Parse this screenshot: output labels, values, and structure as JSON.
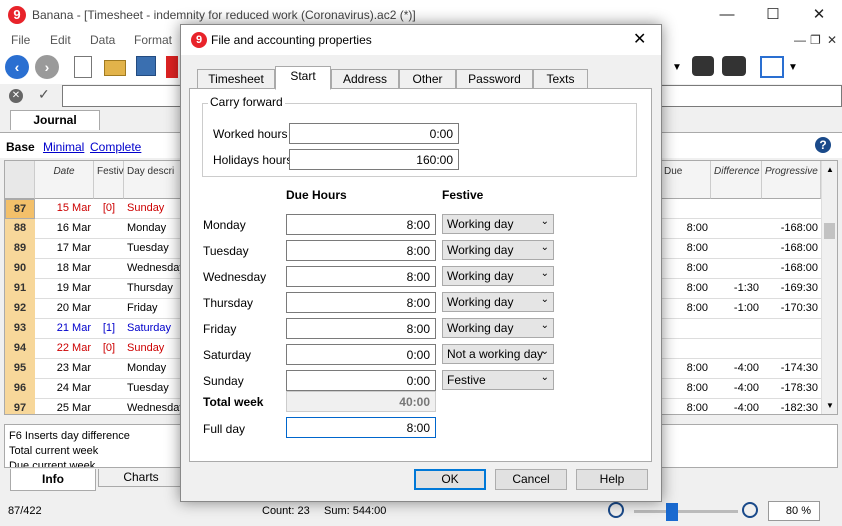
{
  "window": {
    "title": "Banana - [Timesheet - indemnity for reduced work (Coronavirus).ac2 (*)]",
    "logo": "9",
    "minimize": "—",
    "maximize": "☐",
    "close": "✕"
  },
  "menu": [
    "File",
    "Edit",
    "Data",
    "Format"
  ],
  "main": {
    "journal_tab": "Journal",
    "views": {
      "base": "Base",
      "minimal": "Minimal",
      "complete": "Complete"
    },
    "help": "?",
    "columns": {
      "date": "Date",
      "festive": "Festive",
      "day": "Day descri",
      "due": "Due",
      "difference": "Difference",
      "progressive": "Progressive"
    },
    "rows": [
      {
        "n": "87",
        "date": "15 Mar",
        "festive": "[0]",
        "day": "Sunday",
        "due": "",
        "diff": "",
        "prog": "",
        "color": "red"
      },
      {
        "n": "88",
        "date": "16 Mar",
        "festive": "",
        "day": "Monday",
        "due": "8:00",
        "diff": "",
        "prog": "-168:00",
        "color": ""
      },
      {
        "n": "89",
        "date": "17 Mar",
        "festive": "",
        "day": "Tuesday",
        "due": "8:00",
        "diff": "",
        "prog": "-168:00",
        "color": ""
      },
      {
        "n": "90",
        "date": "18 Mar",
        "festive": "",
        "day": "Wednesday",
        "due": "8:00",
        "diff": "",
        "prog": "-168:00",
        "color": ""
      },
      {
        "n": "91",
        "date": "19 Mar",
        "festive": "",
        "day": "Thursday",
        "due": "8:00",
        "diff": "-1:30",
        "prog": "-169:30",
        "color": ""
      },
      {
        "n": "92",
        "date": "20 Mar",
        "festive": "",
        "day": "Friday",
        "due": "8:00",
        "diff": "-1:00",
        "prog": "-170:30",
        "color": ""
      },
      {
        "n": "93",
        "date": "21 Mar",
        "festive": "[1]",
        "day": "Saturday",
        "due": "",
        "diff": "",
        "prog": "",
        "color": "blue"
      },
      {
        "n": "94",
        "date": "22 Mar",
        "festive": "[0]",
        "day": "Sunday",
        "due": "",
        "diff": "",
        "prog": "",
        "color": "red"
      },
      {
        "n": "95",
        "date": "23 Mar",
        "festive": "",
        "day": "Monday",
        "due": "8:00",
        "diff": "-4:00",
        "prog": "-174:30",
        "color": ""
      },
      {
        "n": "96",
        "date": "24 Mar",
        "festive": "",
        "day": "Tuesday",
        "due": "8:00",
        "diff": "-4:00",
        "prog": "-178:30",
        "color": ""
      },
      {
        "n": "97",
        "date": "25 Mar",
        "festive": "",
        "day": "Wednesday",
        "due": "8:00",
        "diff": "-4:00",
        "prog": "-182:30",
        "color": ""
      }
    ],
    "info_lines": [
      "F6 Inserts day difference",
      "Total current week",
      "Due current week"
    ],
    "info_tab": "Info",
    "charts_tab": "Charts",
    "status": {
      "position": "87/422",
      "count": "Count: 23",
      "sum": "Sum: 544:00",
      "zoom": "80 %"
    }
  },
  "dialog": {
    "logo": "9",
    "title": "File and accounting properties",
    "close": "✕",
    "tabs": [
      "Timesheet",
      "Start",
      "Address",
      "Other",
      "Password",
      "Texts"
    ],
    "active_tab": "Start",
    "carry_forward": {
      "legend": "Carry forward",
      "worked_label": "Worked hours",
      "worked_value": "0:00",
      "holidays_label": "Holidays hours",
      "holidays_value": "160:00"
    },
    "due_hours_header": "Due Hours",
    "festive_header": "Festive",
    "days": [
      {
        "label": "Monday",
        "hours": "8:00",
        "festive": "Working day"
      },
      {
        "label": "Tuesday",
        "hours": "8:00",
        "festive": "Working day"
      },
      {
        "label": "Wednesday",
        "hours": "8:00",
        "festive": "Working day"
      },
      {
        "label": "Thursday",
        "hours": "8:00",
        "festive": "Working day"
      },
      {
        "label": "Friday",
        "hours": "8:00",
        "festive": "Working day"
      },
      {
        "label": "Saturday",
        "hours": "0:00",
        "festive": "Not a working day"
      },
      {
        "label": "Sunday",
        "hours": "0:00",
        "festive": "Festive"
      }
    ],
    "total_week_label": "Total week",
    "total_week_value": "40:00",
    "full_day_label": "Full day",
    "full_day_value": "8:00",
    "buttons": {
      "ok": "OK",
      "cancel": "Cancel",
      "help": "Help"
    }
  }
}
